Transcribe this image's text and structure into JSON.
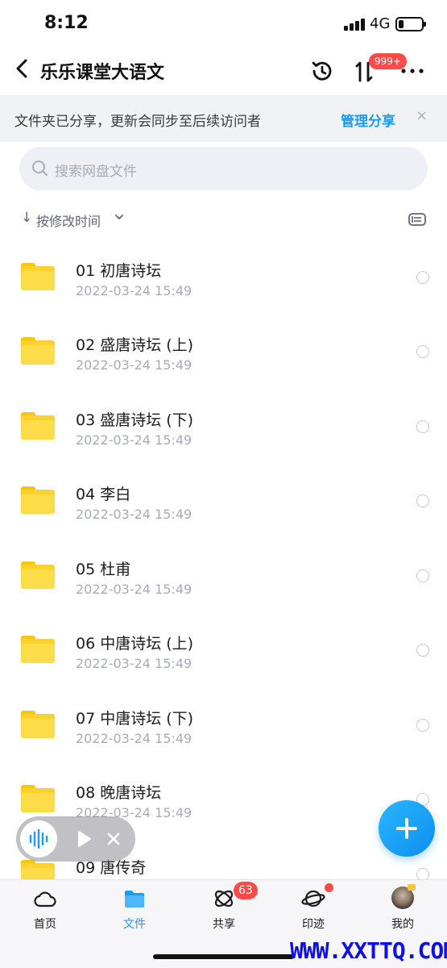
{
  "status_bar": {
    "time": "8:12",
    "network": "4G"
  },
  "nav": {
    "title": "乐乐课堂大语文",
    "transfer_badge": "999+"
  },
  "share_banner": {
    "text": "文件夹已分享，更新会同步至后续访问者",
    "action": "管理分享",
    "close": "×"
  },
  "search": {
    "placeholder": "搜索网盘文件"
  },
  "sort": {
    "arrow": "↓",
    "label": "按修改时间"
  },
  "files": [
    {
      "name": "01 初唐诗坛",
      "date": "2022-03-24 15:49"
    },
    {
      "name": "02 盛唐诗坛 (上)",
      "date": "2022-03-24 15:49"
    },
    {
      "name": "03 盛唐诗坛 (下)",
      "date": "2022-03-24 15:49"
    },
    {
      "name": "04 李白",
      "date": "2022-03-24 15:49"
    },
    {
      "name": "05 杜甫",
      "date": "2022-03-24 15:49"
    },
    {
      "name": "06 中唐诗坛 (上)",
      "date": "2022-03-24 15:49"
    },
    {
      "name": "07 中唐诗坛 (下)",
      "date": "2022-03-24 15:49"
    },
    {
      "name": "08 晚唐诗坛",
      "date": "2022-03-24 15:49"
    },
    {
      "name": "09 唐传奇",
      "date": ""
    }
  ],
  "tabs": [
    {
      "label": "首页",
      "icon": "cloud-icon"
    },
    {
      "label": "文件",
      "icon": "folder-icon",
      "active": true
    },
    {
      "label": "共享",
      "icon": "orbit-icon",
      "badge": "63"
    },
    {
      "label": "印迹",
      "icon": "planet-icon",
      "dot": true
    },
    {
      "label": "我的",
      "icon": "avatar"
    }
  ],
  "watermark": "WWW.XXTTQ.COM",
  "colors": {
    "accent": "#1a9cf0",
    "badge": "#ff4a4a",
    "folder": "#fbd22d"
  }
}
